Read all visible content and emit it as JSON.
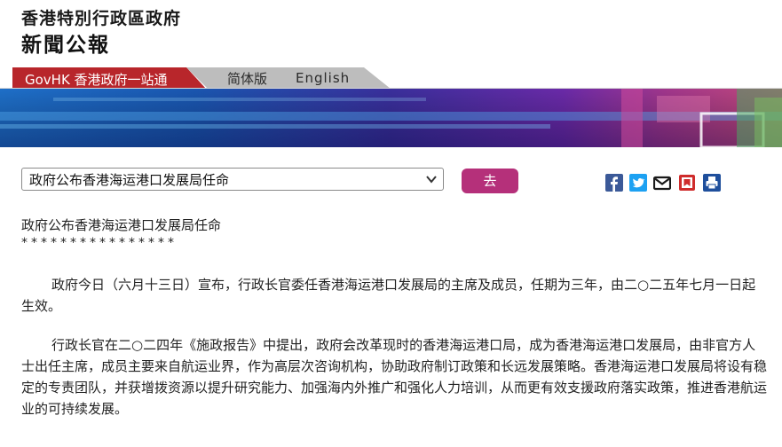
{
  "header": {
    "gov_title": "香港特別行政區政府",
    "press_title": "新聞公報"
  },
  "nav": {
    "govhk": "GovHK 香港政府一站通",
    "simplified": "简体版",
    "english": "English",
    "colors": {
      "govhk_bg": "#b8262b",
      "tab_bg": "#bdbdbd"
    }
  },
  "selector": {
    "selected": "政府公布香港海运港口发展局任命",
    "go_label": "去"
  },
  "share_icons": [
    "facebook-icon",
    "twitter-icon",
    "email-icon",
    "bookmark-icon",
    "print-icon"
  ],
  "article": {
    "title": "政府公布香港海运港口发展局任命",
    "stars": "****************",
    "paragraphs": [
      "政府今日（六月十三日）宣布，行政长官委任香港海运港口发展局的主席及成员，任期为三年，由二○二五年七月一日起生效。",
      "行政长官在二○二四年《施政报告》中提出，政府会改革现时的香港海运港口局，成为香港海运港口发展局，由非官方人士出任主席，成员主要来自航运业界，作为高层次咨询机构，协助政府制订政策和长远发展策略。香港海运港口发展局将设有稳定的专责团队，并获增拨资源以提升研究能力、加强海内外推广和强化人力培训，从而更有效支援政府落实政策，推进香港航运业的可持续发展。"
    ]
  },
  "colors": {
    "accent": "#b5307a",
    "text": "#222222"
  }
}
